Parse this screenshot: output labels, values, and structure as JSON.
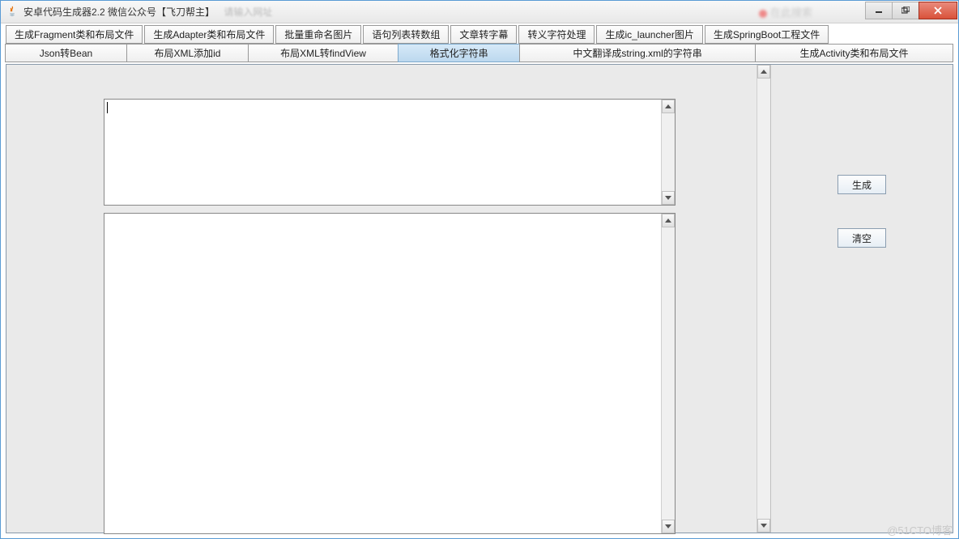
{
  "window": {
    "title": "安卓代码生成器2.2 微信公众号【飞刀帮主】",
    "blur_text1": "请输入网址",
    "blur_text2": "在此搜索"
  },
  "tabs_row1": [
    "生成Fragment类和布局文件",
    "生成Adapter类和布局文件",
    "批量重命名图片",
    "语句列表转数组",
    "文章转字幕",
    "转义字符处理",
    "生成ic_launcher图片",
    "生成SpringBoot工程文件"
  ],
  "tabs_row2": [
    {
      "label": "Json转Bean",
      "active": false
    },
    {
      "label": "布局XML添加id",
      "active": false
    },
    {
      "label": "布局XML转findView",
      "active": false
    },
    {
      "label": "格式化字符串",
      "active": true
    },
    {
      "label": "中文翻译成string.xml的字符串",
      "active": false
    },
    {
      "label": "生成Activity类和布局文件",
      "active": false
    }
  ],
  "buttons": {
    "generate": "生成",
    "clear": "清空"
  },
  "watermark": "@51CTO博客"
}
